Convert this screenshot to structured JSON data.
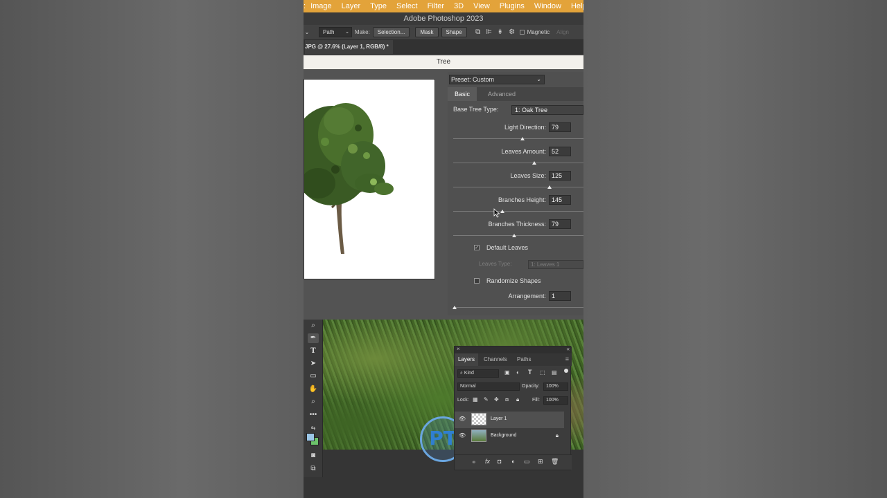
{
  "menu": {
    "items": [
      "Image",
      "Layer",
      "Type",
      "Select",
      "Filter",
      "3D",
      "View",
      "Plugins",
      "Window",
      "Help"
    ],
    "edge_char": ":"
  },
  "window": {
    "title": "Adobe Photoshop 2023"
  },
  "options": {
    "mode": "Path",
    "make_label": "Make:",
    "selection_btn": "Selection...",
    "mask_btn": "Mask",
    "shape_btn": "Shape",
    "magnetic_label": "Magnetic",
    "align_label": "Align"
  },
  "document": {
    "tab_label": "JPG @ 27.6% (Layer 1, RGB/8) *"
  },
  "dialog": {
    "title": "Tree",
    "preset": "Preset: Custom",
    "tab_basic": "Basic",
    "tab_advanced": "Advanced",
    "base_tree_label": "Base Tree Type:",
    "base_tree_value": "1: Oak Tree",
    "params": [
      {
        "label": "Light Direction:",
        "value": "79",
        "pos": 0.53
      },
      {
        "label": "Leaves Amount:",
        "value": "52",
        "pos": 0.62
      },
      {
        "label": "Leaves Size:",
        "value": "125",
        "pos": 0.74
      },
      {
        "label": "Branches Height:",
        "value": "145",
        "pos": 0.38
      },
      {
        "label": "Branches Thickness:",
        "value": "79",
        "pos": 0.47
      }
    ],
    "default_leaves_label": "Default Leaves",
    "default_leaves_checked": true,
    "leaves_type_label": "Leaves Type:",
    "leaves_type_value": "1: Leaves 1",
    "randomize_label": "Randomize Shapes",
    "randomize_checked": false,
    "arrangement_label": "Arrangement:",
    "arrangement_value": "1",
    "arrangement_pos": 0.01
  },
  "layers_panel": {
    "tabs": [
      "Layers",
      "Channels",
      "Paths"
    ],
    "kind_label": "Kind",
    "blend_mode": "Normal",
    "opacity_label": "Opacity:",
    "opacity_value": "100%",
    "lock_label": "Lock:",
    "fill_label": "Fill:",
    "fill_value": "100%",
    "layers": [
      {
        "name": "Layer 1",
        "selected": true
      },
      {
        "name": "Background",
        "selected": false,
        "locked": true
      }
    ]
  },
  "watermark": {
    "text": "PT"
  },
  "colors": {
    "menu_bar": "#e3a33a",
    "dialog_title_bg": "#f3f1ec"
  }
}
